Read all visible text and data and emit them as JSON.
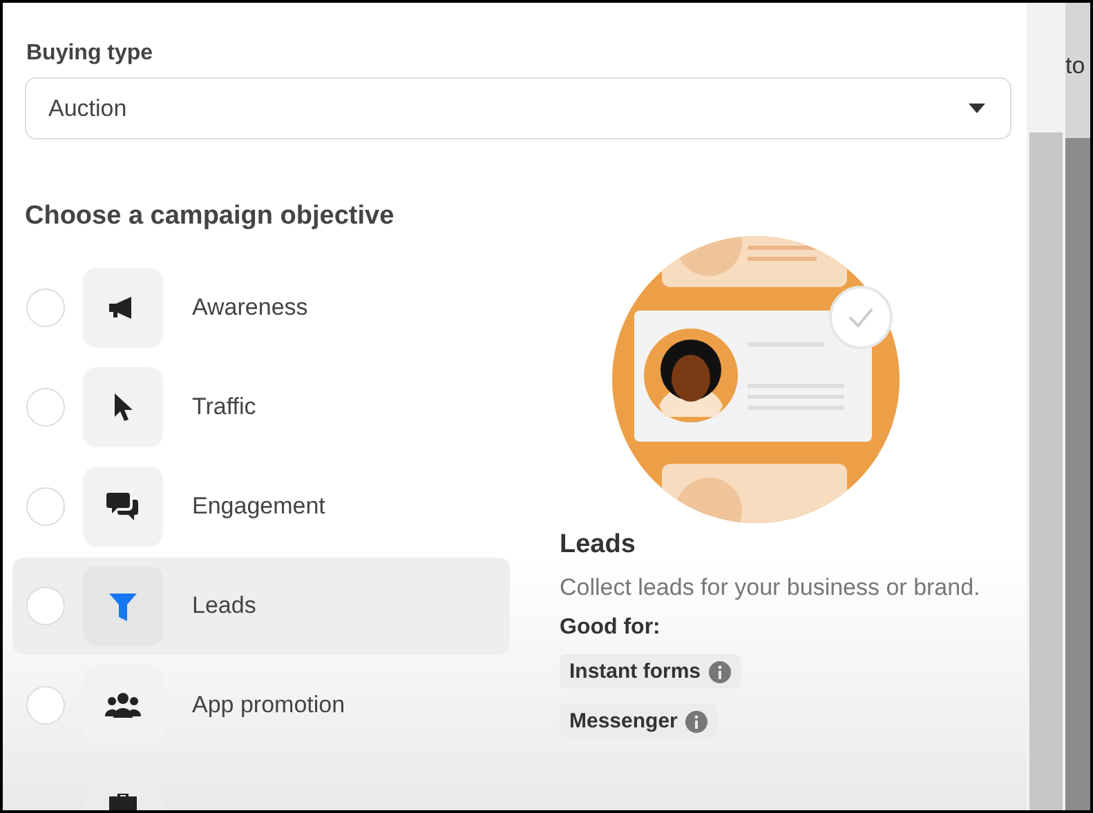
{
  "buying_type": {
    "label": "Buying type",
    "value": "Auction"
  },
  "objective": {
    "heading": "Choose a campaign objective",
    "options": [
      {
        "label": "Awareness",
        "selected": false,
        "hovered": false
      },
      {
        "label": "Traffic",
        "selected": false,
        "hovered": false
      },
      {
        "label": "Engagement",
        "selected": false,
        "hovered": false
      },
      {
        "label": "Leads",
        "selected": false,
        "hovered": true
      },
      {
        "label": "App promotion",
        "selected": false,
        "hovered": false
      }
    ]
  },
  "detail": {
    "title": "Leads",
    "description": "Collect leads for your business or brand.",
    "good_for_label": "Good for:",
    "tags": [
      "Instant forms",
      "Messenger"
    ]
  },
  "background_page": {
    "text": "to"
  }
}
